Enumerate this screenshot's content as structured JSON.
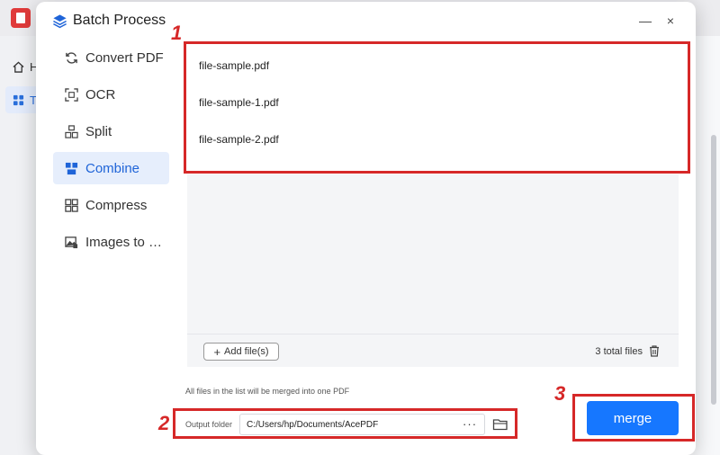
{
  "background": {
    "nav_home_label": "H",
    "nav_tools_label": "T"
  },
  "dialog": {
    "title": "Batch Process",
    "minimize_glyph": "—",
    "close_glyph": "×"
  },
  "sidebar": {
    "items": [
      {
        "label": "Convert PDF",
        "icon": "convert-icon",
        "active": false
      },
      {
        "label": "OCR",
        "icon": "ocr-icon",
        "active": false
      },
      {
        "label": "Split",
        "icon": "split-icon",
        "active": false
      },
      {
        "label": "Combine",
        "icon": "combine-icon",
        "active": true
      },
      {
        "label": "Compress",
        "icon": "compress-icon",
        "active": false
      },
      {
        "label": "Images to …",
        "icon": "images-icon",
        "active": false
      }
    ]
  },
  "files": {
    "items": [
      "file-sample.pdf",
      "file-sample-1.pdf",
      "file-sample-2.pdf"
    ],
    "add_label": "Add file(s)",
    "total_label": "3 total files"
  },
  "hint": "All files in the list will be merged into one PDF",
  "output": {
    "label": "Output folder",
    "path": "C:/Users/hp/Documents/AcePDF",
    "more_glyph": "···"
  },
  "merge_label": "merge",
  "annotations": [
    "1",
    "2",
    "3"
  ],
  "colors": {
    "accent": "#1677ff",
    "annotation": "#d62828",
    "active_bg": "#e6eefc"
  }
}
